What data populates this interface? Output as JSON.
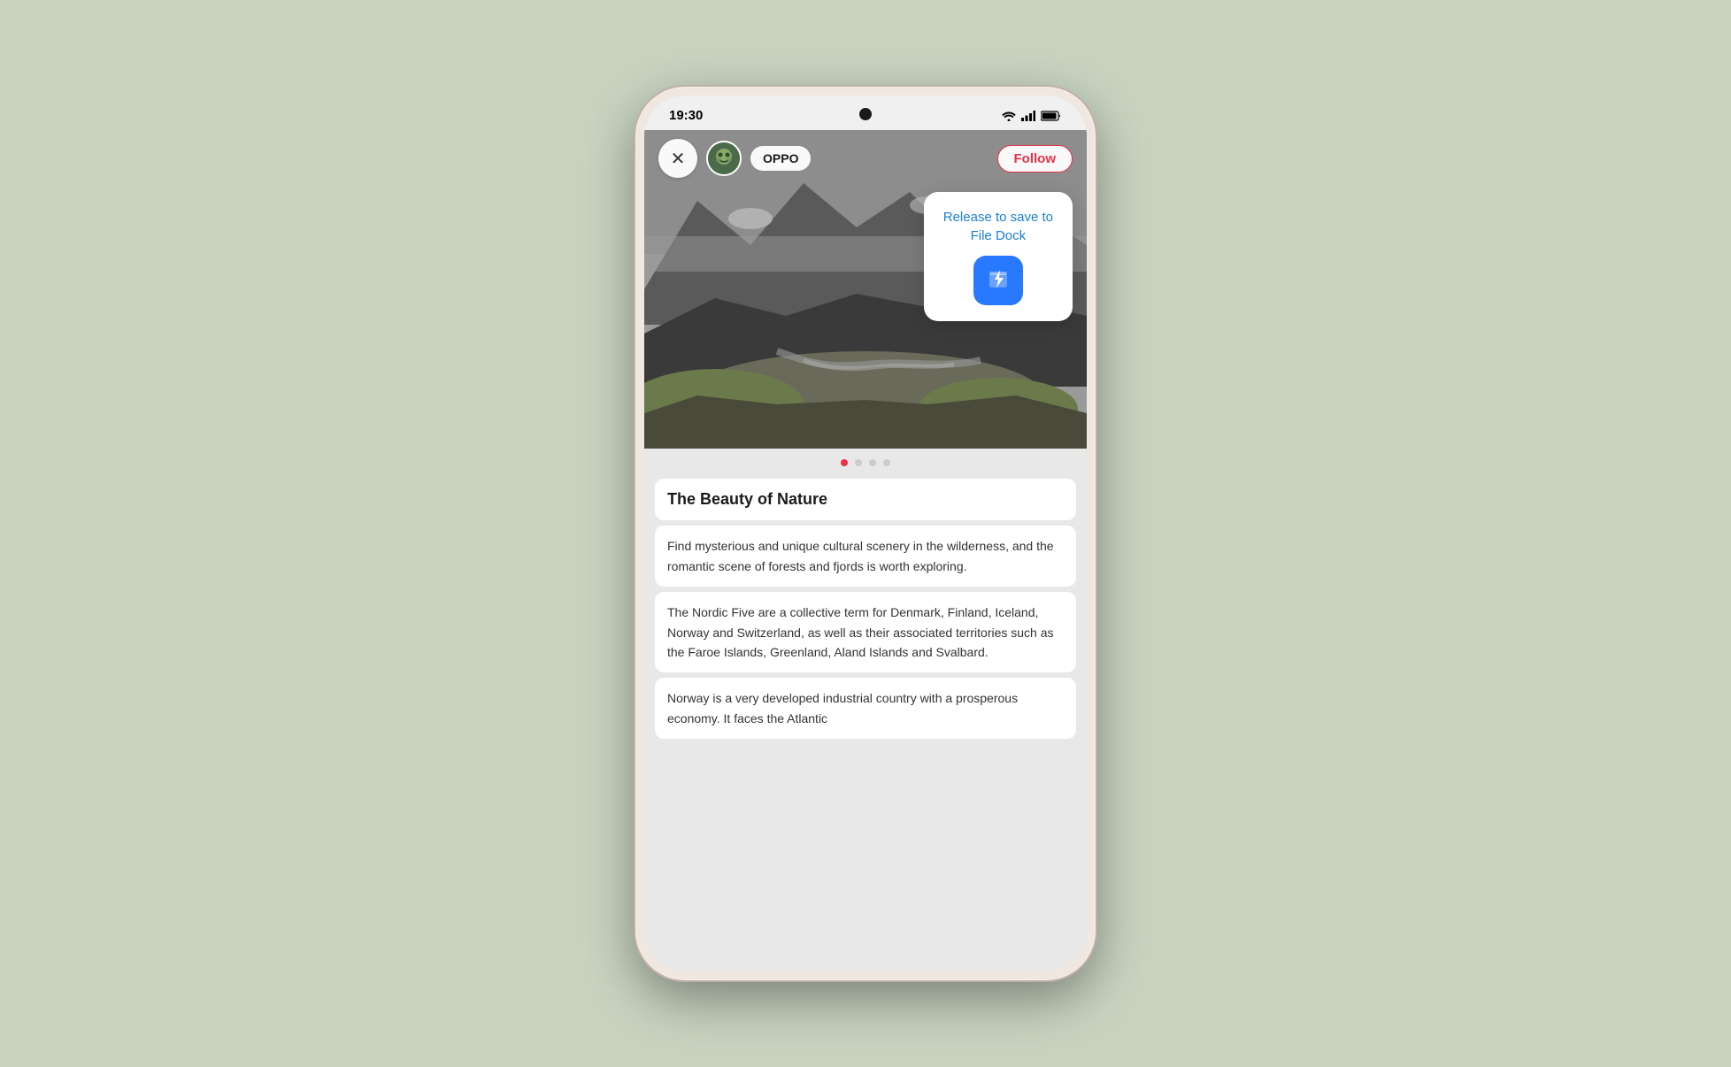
{
  "statusBar": {
    "time": "19:30",
    "wifi": "📶",
    "signal": "📶",
    "battery": "🔋"
  },
  "topBar": {
    "closeLabel": "✕",
    "username": "OPPO",
    "followLabel": "Follow"
  },
  "fileDock": {
    "tooltipText": "Release to save to\nFile Dock"
  },
  "dots": [
    {
      "active": true
    },
    {
      "active": false
    },
    {
      "active": false
    },
    {
      "active": false
    }
  ],
  "article": {
    "title": "The Beauty of Nature",
    "paragraph1": "Find mysterious and unique cultural scenery in the wilderness, and the romantic scene of forests and fjords is worth exploring.",
    "paragraph2": "The Nordic Five are a collective term for Denmark, Finland, Iceland, Norway and Switzerland, as well as their associated territories such as the Faroe Islands, Greenland, Aland Islands and Svalbard.",
    "paragraph3": "Norway is a very developed industrial country with a prosperous economy. It faces the Atlantic"
  }
}
